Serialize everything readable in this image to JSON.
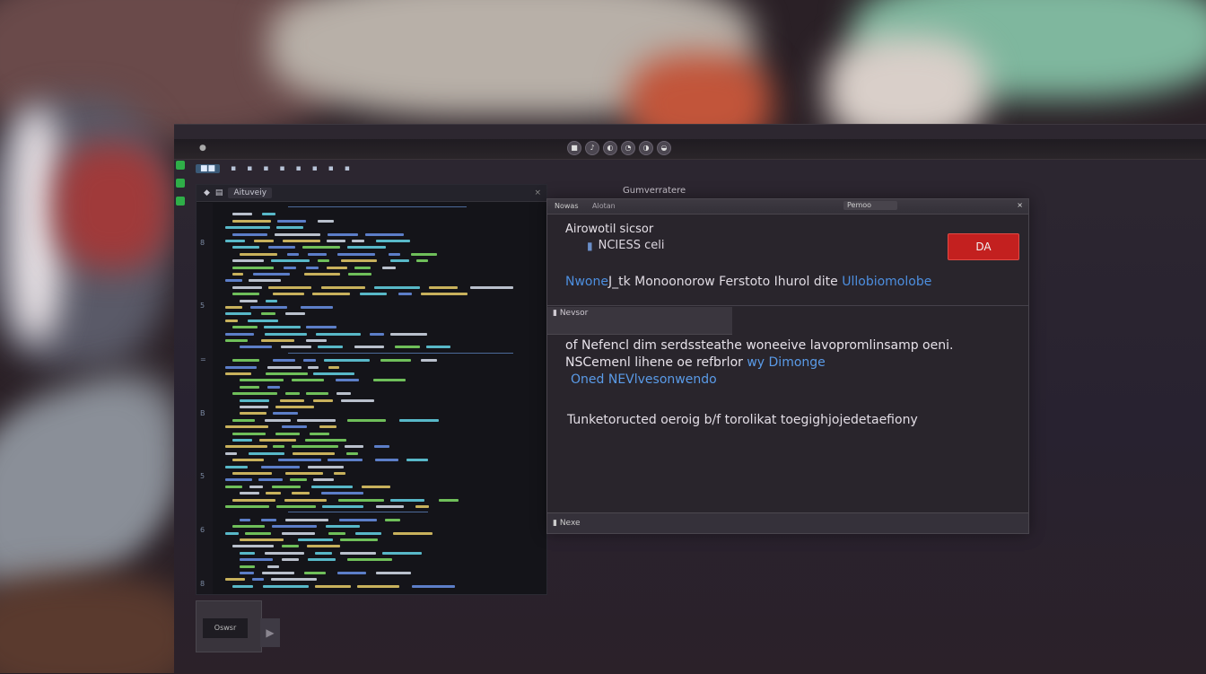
{
  "topbar": {
    "app_icon": "app-icon",
    "center_icons": [
      "■",
      "♪",
      "◐",
      "◔",
      "◑",
      "◒"
    ]
  },
  "menubar": {
    "items": [
      "■",
      "▪",
      "▪",
      "▪",
      "▪",
      "▪",
      "▪",
      "▪",
      "▪"
    ],
    "active": "■■"
  },
  "window_title": "Gumverratere",
  "editor": {
    "tab_label": "Aituveiy",
    "close": "×",
    "gutter_marks": [
      "8",
      "5",
      "=",
      "B",
      "5",
      "6",
      "8"
    ]
  },
  "dialog": {
    "titlebar_left": "Nowas",
    "titlebar_mid": "Alotan",
    "titlebar_segment": "Pemoo",
    "close": "×",
    "heading": "Airowotil sicsor",
    "sub_label": "NCIESS celi",
    "action_button": "DA",
    "description": {
      "prefix": "Nwone",
      "mid": "J_tk  Monoonorow  Ferstoto  Ihurol  dite",
      "link": "Ullobiomolobe"
    },
    "tab2_label": "Nevsor",
    "body_line1": "of Nefencl dim serdssteathe woneeive  lavopromlinsamp oeni.",
    "body_line2_a": "NSCemenl lihene oe refbrlor",
    "body_line2_b": "wy  Dimonge",
    "body_line3": "Oned NEVlvesonwendo",
    "body_note": "Tunketoructed oeroig b/f torolikat toegighjojedetaefiony",
    "footer": "Nexe"
  },
  "thumbnail": {
    "button": "Oswsr",
    "arrow": "▶"
  },
  "colors": {
    "accent_red": "#c3201f",
    "link_blue": "#4d8fe0",
    "code_green": "#6fbf5a"
  }
}
